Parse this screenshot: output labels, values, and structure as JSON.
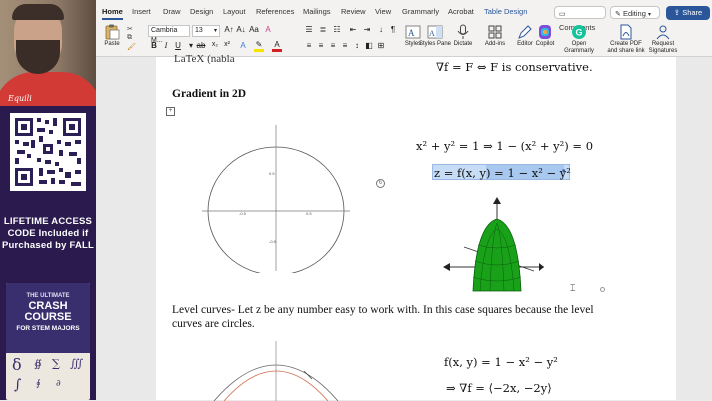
{
  "sidebar": {
    "webcam_shirt_text": "Equili",
    "promo_lines": [
      "LIFETIME ACCESS",
      "CODE Included if",
      "Purchased by FALL"
    ],
    "course": {
      "kicker": "THE ULTIMATE",
      "title_line1": "CRASH COURSE",
      "subtitle": "FOR STEM MAJORS"
    }
  },
  "ribbon": {
    "tabs": [
      "Home",
      "Insert",
      "Draw",
      "Design",
      "Layout",
      "References",
      "Mailings",
      "Review",
      "View",
      "Grammarly",
      "Acrobat",
      "Table Design"
    ],
    "active_tab": "Home",
    "comments_label": "Comments",
    "editing_label": "Editing",
    "share_label": "Share",
    "paste_label": "Paste",
    "font_name": "Cambria M...",
    "font_size": "13",
    "buttons": {
      "styles": "Styles",
      "styles_pane": "Styles Pane",
      "dictate": "Dictate",
      "add_ins": "Add-ins",
      "editor": "Editor",
      "copilot": "Copilot",
      "grammarly": "Open Grammarly",
      "create_pdf": "Create PDF and share link",
      "request_sig": "Request Signatures"
    },
    "colors": {
      "accent": "#2b579a",
      "share_bg": "#2b579a"
    }
  },
  "document": {
    "top_fragment": "LaTeX (nabla",
    "top_math": "∇f = F ⇔ F is conservative.",
    "heading": "Gradient in 2D",
    "eq1": "x² + y² = 1 ⇒ 1 − (x² + y²) = 0",
    "eq2": "z = f(x, y) = 1 − x² − y²",
    "level_text": "Level curves- Let z be any number easy to work with. In this case squares because the level curves are circles.",
    "eq3": "f(x, y) = 1 − x² − y²",
    "eq4": "⇒ ∇f = ⟨−2x, −2y⟩",
    "graph_ticks": {
      "pos": "0.5",
      "neg": "-0.5"
    }
  }
}
